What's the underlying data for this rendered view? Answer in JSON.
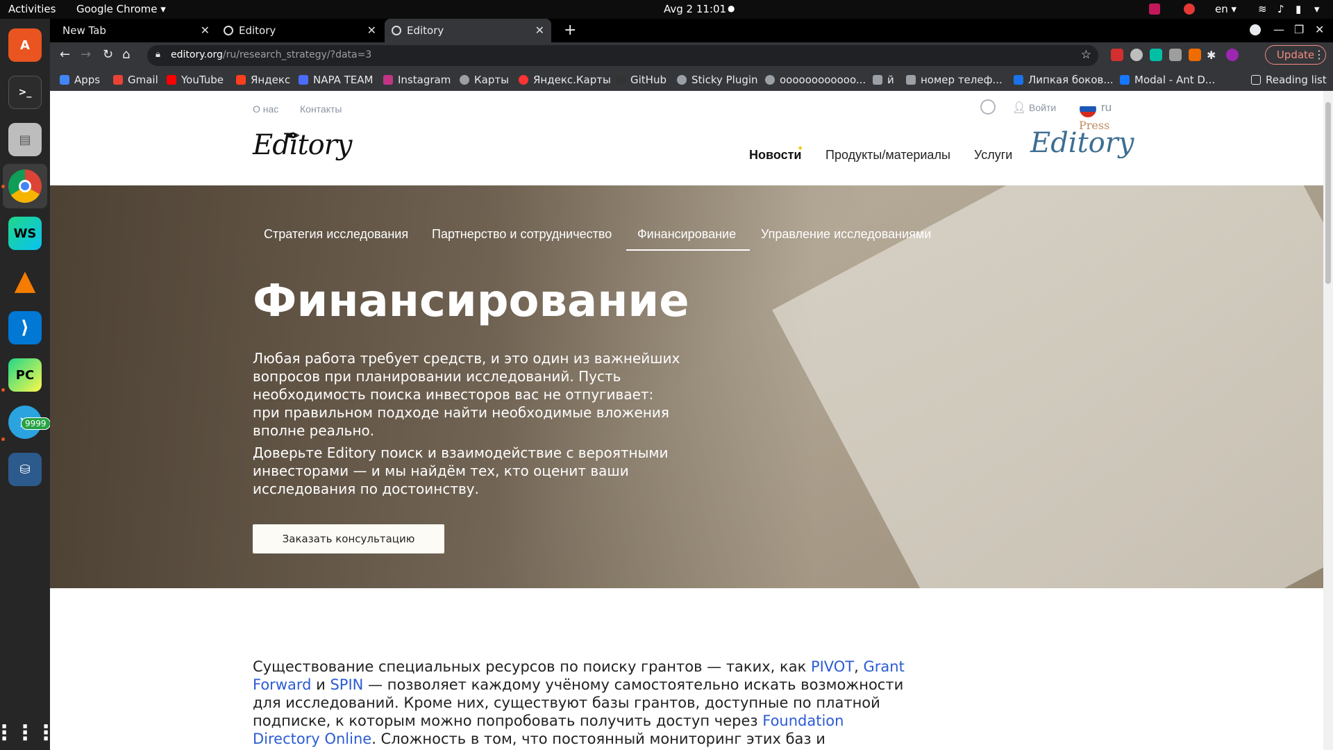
{
  "topbar": {
    "activities": "Activities",
    "app_menu": "Google Chrome ▾",
    "clock": "Avg 2  11:01",
    "lang": "en ▾"
  },
  "dock": {
    "telegram_badge": "9999"
  },
  "tabs": [
    {
      "title": "New Tab",
      "close": "✕"
    },
    {
      "title": "Editory",
      "close": "✕"
    },
    {
      "title": "Editory",
      "close": "✕"
    }
  ],
  "new_tab": "+",
  "toolbar": {
    "url_host": "editory.org",
    "url_path": "/ru/research_strategy/?data=3",
    "update_label": "Update"
  },
  "bookmarks": [
    {
      "label": "Apps",
      "color": "#4285f4"
    },
    {
      "label": "Gmail",
      "color": "#ea4335"
    },
    {
      "label": "YouTube",
      "color": "#ff0000"
    },
    {
      "label": "Яндекс",
      "color": "#fc3f1d"
    },
    {
      "label": "NAPA TEAM",
      "color": "#4a6cf7"
    },
    {
      "label": "Instagram",
      "color": "#c13584"
    },
    {
      "label": "Карты",
      "color": "#9aa0a6"
    },
    {
      "label": "Яндекс.Карты",
      "color": "#ff3333"
    },
    {
      "label": "GitHub",
      "color": "#333333"
    },
    {
      "label": "Sticky Plugin",
      "color": "#9aa0a6"
    },
    {
      "label": "oooooooooooo...",
      "color": "#9aa0a6"
    },
    {
      "label": "й",
      "color": "#9aa0a6"
    },
    {
      "label": "номер телеф...",
      "color": "#9aa0a6"
    },
    {
      "label": "Липкая боков...",
      "color": "#1a73e8"
    },
    {
      "label": "Modal - Ant D...",
      "color": "#1677ff"
    }
  ],
  "reading_list": "Reading list",
  "site": {
    "top_links": [
      "О нас",
      "Контакты"
    ],
    "login": "Войти",
    "lang": "ru",
    "logo": "Editory",
    "nav": [
      "Новости",
      "Продукты/материалы",
      "Услуги"
    ],
    "press_logo": "Editory",
    "press_logo_small": "Press",
    "subtabs": [
      "Стратегия исследования",
      "Партнерство и сотрудничество",
      "Финансирование",
      "Управление исследованиями"
    ],
    "hero_title": "Финансирование",
    "hero_p1": "Любая работа требует средств, и это один из важнейших вопросов при планировании исследований. Пусть необходимость поиска инвесторов вас не отпугивает: при правильном подходе найти необходимые вложения вполне реально.",
    "hero_p2": "Доверьте Editory поиск и взаимодействие с вероятными инвесторами — и мы найдём тех, кто оценит ваши исследования по достоинству.",
    "cta": "Заказать консультацию",
    "content": {
      "t1": "Существование специальных ресурсов по поиску грантов — таких, как ",
      "link1": "PIVOT",
      "t2": ", ",
      "link2": "Grant Forward",
      "t3": " и ",
      "link3": "SPIN",
      "t4": " — позволяет каждому учёному самостоятельно искать возможности для исследований. Кроме них, существуют базы грантов, доступные по платной подписке, к которым можно попробовать получить доступ через ",
      "link4": "Foundation Directory Online",
      "t5": ". Сложность в том, что постоянный мониторинг этих баз и требований к заявкам, которые"
    }
  }
}
